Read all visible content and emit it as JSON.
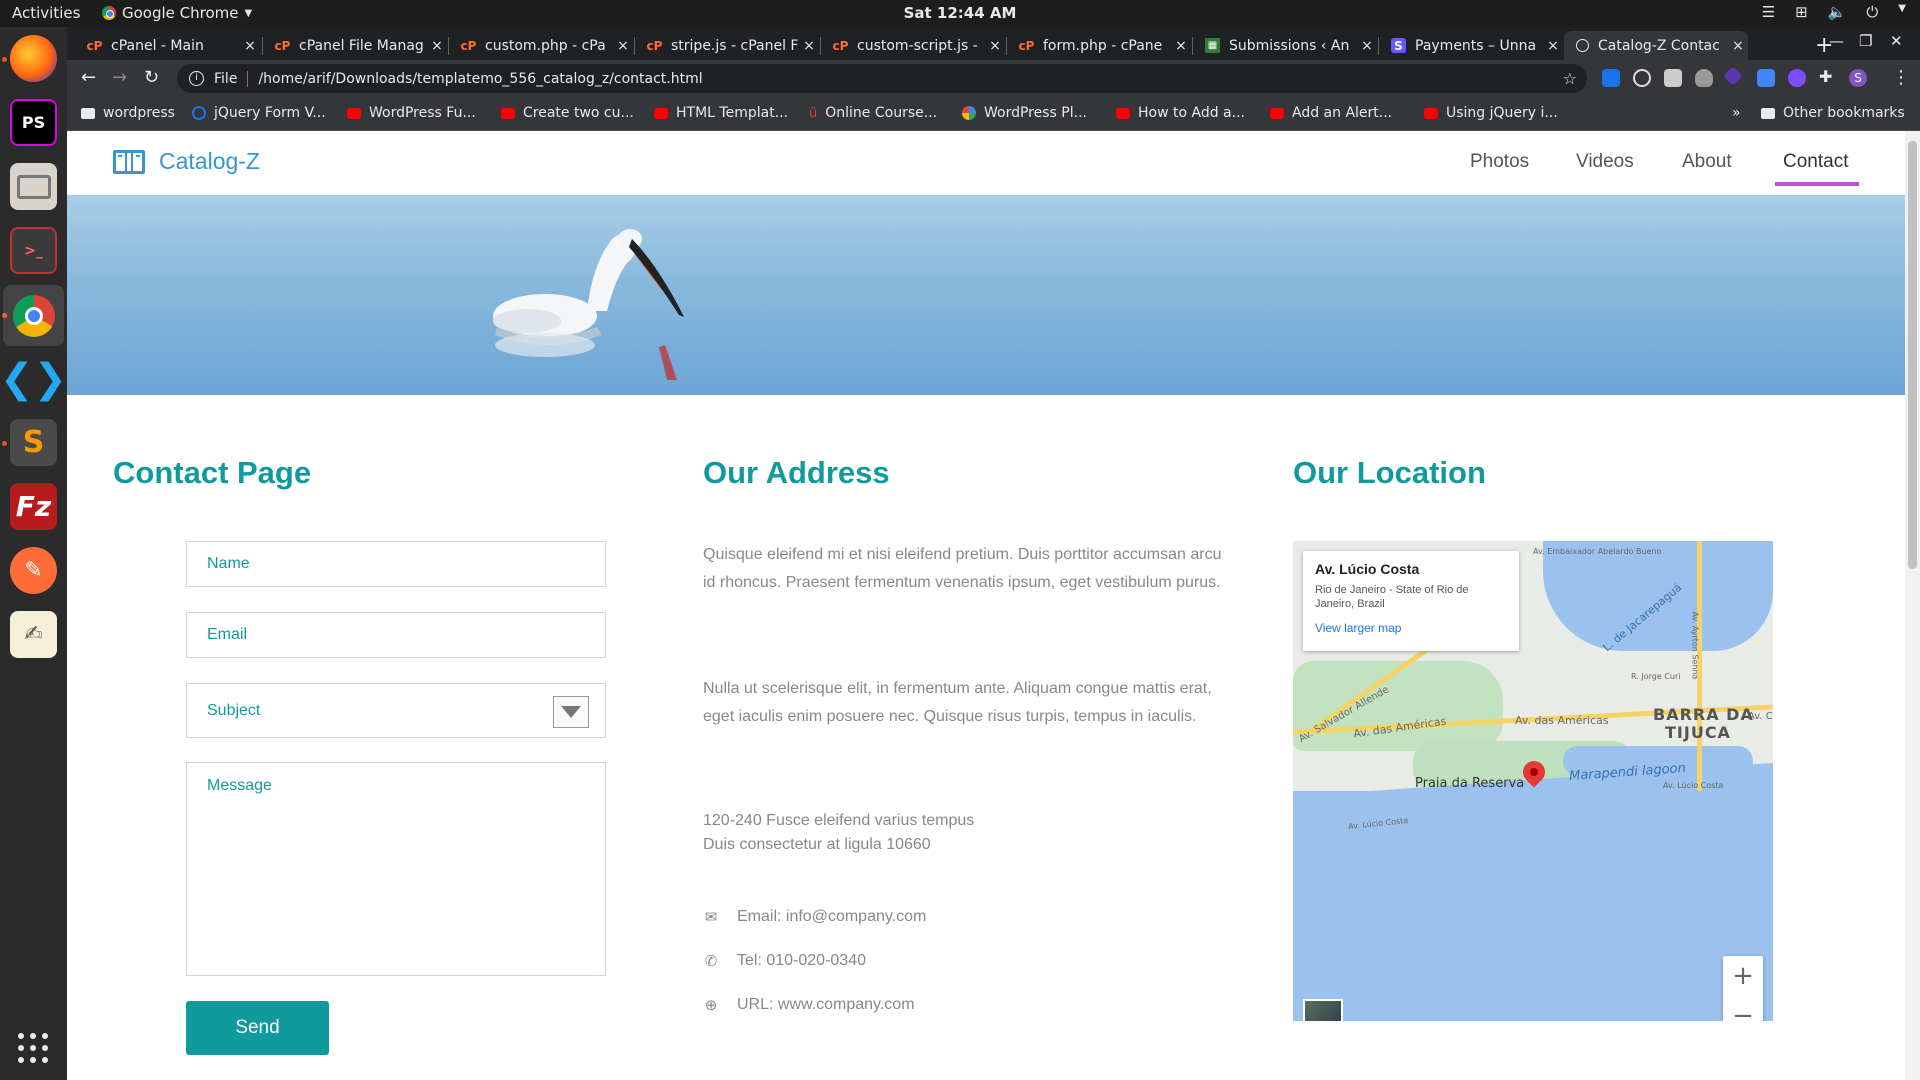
{
  "os": {
    "activities": "Activities",
    "app_name": "Google Chrome",
    "clock": "Sat 12:44 AM"
  },
  "dock": [
    "firefox",
    "phpstorm",
    "files",
    "terminal",
    "chrome",
    "vscode",
    "sublime",
    "filezilla",
    "postman",
    "text-editor"
  ],
  "tabs": [
    {
      "label": "cPanel - Main",
      "icon": "cpanel"
    },
    {
      "label": "cPanel File Manag",
      "icon": "cpanel"
    },
    {
      "label": "custom.php - cPa",
      "icon": "cpanel"
    },
    {
      "label": "stripe.js - cPanel F",
      "icon": "cpanel"
    },
    {
      "label": "custom-script.js -",
      "icon": "cpanel"
    },
    {
      "label": "form.php - cPane",
      "icon": "cpanel"
    },
    {
      "label": "Submissions ‹ An",
      "icon": "forms"
    },
    {
      "label": "Payments – Unna",
      "icon": "stripe"
    },
    {
      "label": "Catalog-Z Contac",
      "icon": "globe"
    }
  ],
  "tab_close": "×",
  "address_bar": {
    "scheme": "File",
    "url": "/home/arif/Downloads/templatemo_556_catalog_z/contact.html"
  },
  "bookmarks": [
    {
      "label": "wordpress",
      "icon": "folder"
    },
    {
      "label": "jQuery Form V...",
      "icon": "jquery"
    },
    {
      "label": "WordPress Fu...",
      "icon": "youtube"
    },
    {
      "label": "Create two cu...",
      "icon": "youtube"
    },
    {
      "label": "HTML Templat...",
      "icon": "youtube"
    },
    {
      "label": "Online Course...",
      "icon": "udemy"
    },
    {
      "label": "WordPress Pl...",
      "icon": "google"
    },
    {
      "label": "How to Add a...",
      "icon": "youtube"
    },
    {
      "label": "Add an Alert...",
      "icon": "youtube"
    },
    {
      "label": "Using jQuery i...",
      "icon": "youtube"
    }
  ],
  "bookmarks_overflow": "»",
  "other_bookmarks": "Other bookmarks",
  "site": {
    "brand": "Catalog-Z",
    "nav": [
      "Photos",
      "Videos",
      "About",
      "Contact"
    ],
    "active_nav": "Contact"
  },
  "contact_form": {
    "title": "Contact Page",
    "name_placeholder": "Name",
    "email_placeholder": "Email",
    "subject_placeholder": "Subject",
    "message_placeholder": "Message",
    "send_label": "Send"
  },
  "address": {
    "title": "Our Address",
    "para1": "Quisque eleifend mi et nisi eleifend pretium. Duis porttitor accumsan arcu id rhoncus. Praesent fermentum venenatis ipsum, eget vestibulum purus.",
    "para2": "Nulla ut scelerisque elit, in fermentum ante. Aliquam congue mattis erat, eget iaculis enim posuere nec. Quisque risus turpis, tempus in iaculis.",
    "street1": "120-240 Fusce eleifend varius tempus",
    "street2": "Duis consectetur at ligula 10660",
    "email": "Email: info@company.com",
    "tel": "Tel: 010-020-0340",
    "url": "URL: www.company.com"
  },
  "location": {
    "title": "Our Location",
    "info_title": "Av. Lúcio Costa",
    "info_sub": "Rio de Janeiro - State of Rio de Janeiro, Brazil",
    "info_link": "View larger map",
    "labels": {
      "barra1": "BARRA DA",
      "barra2": "TIJUCA",
      "praia": "Praia da Reserva",
      "lagoon": "Marapendi lagoon",
      "americas1": "Av. das Américas",
      "americas2": "Av. das Américas",
      "salvador": "Av. Salvador Allende",
      "lucio1": "Av. Lúcio Costa",
      "lucio2": "Av. Lúcio Costa",
      "jorge": "R. Jorge Curi",
      "embaixador": "Av. Embaixador Abelardo Bueno",
      "jacarepagua": "L. de Jacarepaguá",
      "ayrton": "Av. Ayrton Senna",
      "av_c": "Av. C"
    },
    "zoom_in": "+",
    "zoom_out": "−"
  },
  "colors": {
    "accent": "#119a9e",
    "brand": "#3496d3",
    "nav_underline": "#c34fd8"
  }
}
